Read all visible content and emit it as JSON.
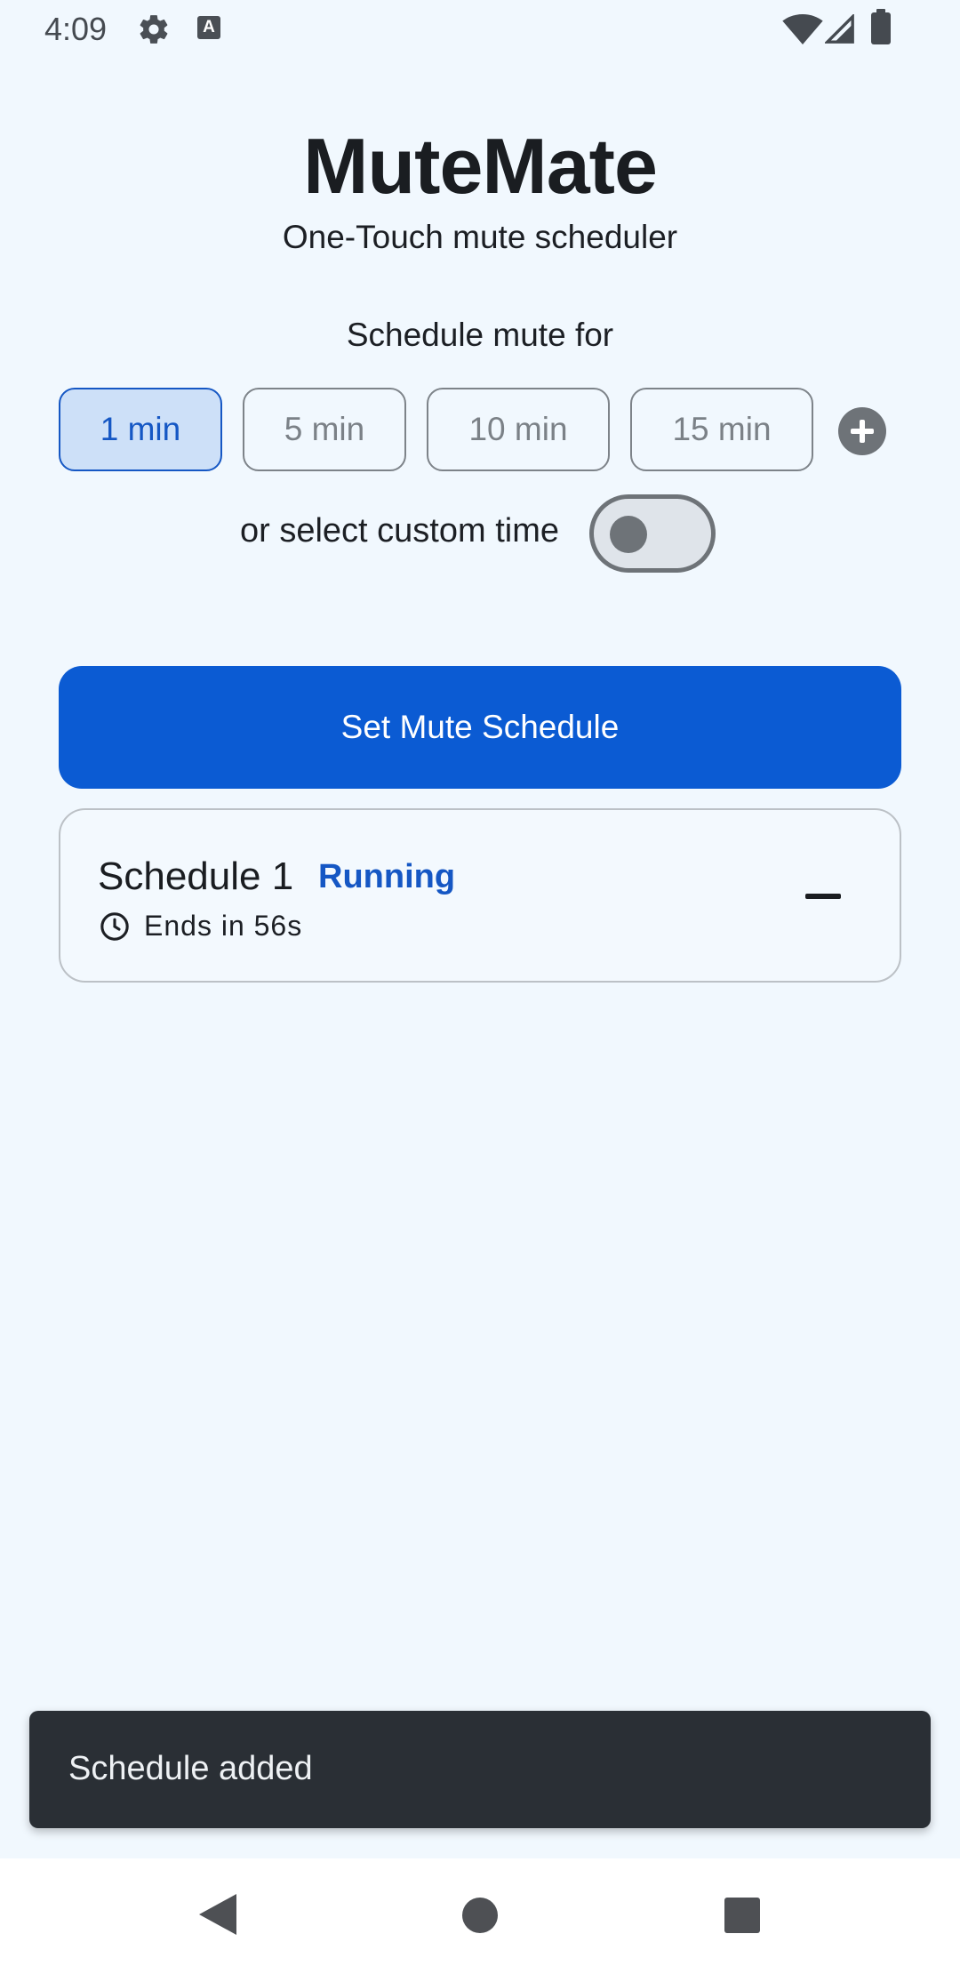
{
  "status_bar": {
    "time": "4:09",
    "icons": [
      "gear-icon",
      "a-notification-icon",
      "wifi-icon",
      "signal-icon",
      "battery-icon"
    ]
  },
  "app": {
    "title": "MuteMate",
    "subtitle": "One-Touch mute scheduler"
  },
  "schedule_section": {
    "label": "Schedule mute for",
    "chips": [
      {
        "label": "1 min",
        "selected": true
      },
      {
        "label": "5 min",
        "selected": false
      },
      {
        "label": "10 min",
        "selected": false
      },
      {
        "label": "15 min",
        "selected": false
      }
    ],
    "add_icon": "plus-circle-icon"
  },
  "custom_time": {
    "label": "or select custom time",
    "toggle_on": false
  },
  "primary_button": {
    "label": "Set Mute Schedule"
  },
  "schedules": [
    {
      "title": "Schedule 1",
      "status": "Running",
      "ends_text": "Ends in 56s",
      "icon": "clock-icon",
      "remove_icon": "minus-icon"
    }
  ],
  "snackbar": {
    "message": "Schedule added"
  },
  "navigation": {
    "back_icon": "back-triangle-icon",
    "home_icon": "home-circle-icon",
    "recents_icon": "recents-square-icon"
  },
  "colors": {
    "background": "#f1f8fe",
    "accent": "#0b5bd3",
    "selected_chip_bg": "#cde0f8",
    "status_running": "#1557c4",
    "snackbar_bg": "#2a2f35"
  }
}
